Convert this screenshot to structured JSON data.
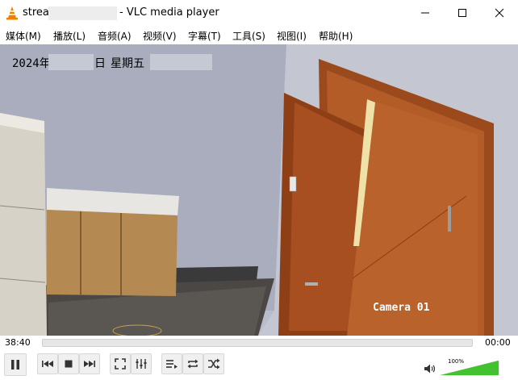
{
  "window": {
    "title_prefix": "strea",
    "title_suffix": "- VLC media player"
  },
  "menu": [
    {
      "label": "媒体(M)"
    },
    {
      "label": "播放(L)"
    },
    {
      "label": "音频(A)"
    },
    {
      "label": "视频(V)"
    },
    {
      "label": "字幕(T)"
    },
    {
      "label": "工具(S)"
    },
    {
      "label": "视图(I)"
    },
    {
      "label": "帮助(H)"
    }
  ],
  "osd": {
    "date_prefix": "2024年",
    "day_suffix": "日",
    "weekday": "星期五",
    "camera": "Camera 01"
  },
  "playback": {
    "elapsed": "38:40",
    "total": "00:00",
    "volume_label": "100%",
    "volume_level": 1.0
  },
  "icons": {
    "app": "vlc-cone-icon",
    "accent": "#f08000"
  }
}
